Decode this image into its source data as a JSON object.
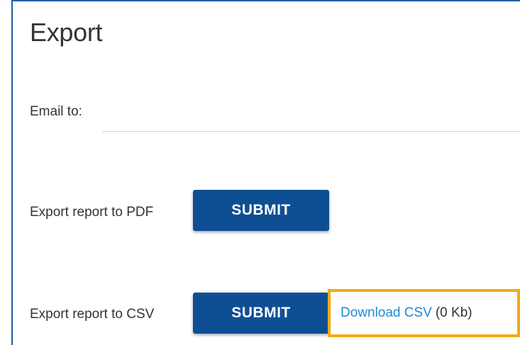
{
  "export": {
    "title": "Export",
    "email": {
      "label": "Email to:",
      "value": "",
      "placeholder": ""
    },
    "pdf": {
      "label": "Export report to PDF",
      "button": "SUBMIT"
    },
    "csv": {
      "label": "Export report to CSV",
      "button": "SUBMIT",
      "download_link": "Download CSV",
      "size": "(0 Kb)"
    }
  },
  "colors": {
    "panel_border": "#1f5fa6",
    "button_bg": "#0e4f94",
    "link": "#1f8ad6",
    "highlight": "#f2ac11"
  }
}
